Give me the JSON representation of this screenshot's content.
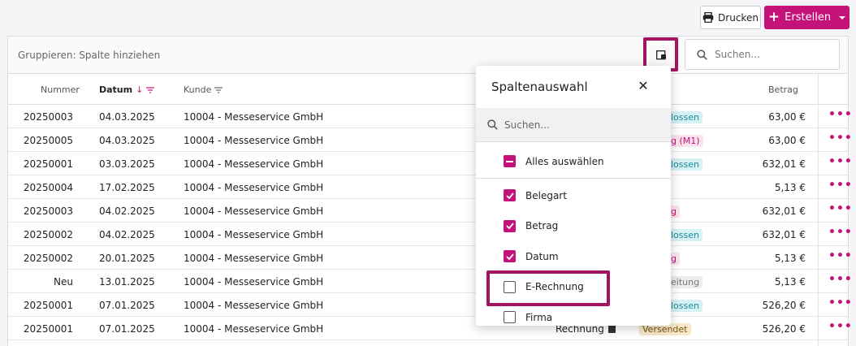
{
  "toolbar": {
    "print_label": "Drucken",
    "create_label": "Erstellen",
    "print_icon": "printer-icon",
    "create_icon": "plus-icon"
  },
  "groupbar": {
    "text": "Gruppieren: Spalte hinziehen",
    "search_placeholder": "Suchen..."
  },
  "columns": {
    "nummer": "Nummer",
    "datum": "Datum",
    "kunde": "Kunde",
    "betrag": "Betrag"
  },
  "rows": [
    {
      "nummer": "20250003",
      "datum": "04.03.2025",
      "kunde": "10004 - Messeservice GmbH",
      "status": "lossen",
      "status_color": "blue",
      "betrag": "63,00 €"
    },
    {
      "nummer": "20250005",
      "datum": "04.03.2025",
      "kunde": "10004 - Messeservice GmbH",
      "status": "g (M1)",
      "status_color": "pink",
      "betrag": "63,00 €"
    },
    {
      "nummer": "20250001",
      "datum": "03.03.2025",
      "kunde": "10004 - Messeservice GmbH",
      "status": "lossen",
      "status_color": "blue",
      "betrag": "632,01 €"
    },
    {
      "nummer": "20250004",
      "datum": "17.02.2025",
      "kunde": "10004 - Messeservice GmbH",
      "status": "",
      "status_color": "none",
      "betrag": "5,13 €"
    },
    {
      "nummer": "20250003",
      "datum": "04.02.2025",
      "kunde": "10004 - Messeservice GmbH",
      "status": "g",
      "status_color": "pink",
      "betrag": "632,01 €"
    },
    {
      "nummer": "20250002",
      "datum": "04.02.2025",
      "kunde": "10004 - Messeservice GmbH",
      "status": "lossen",
      "status_color": "blue",
      "betrag": "632,01 €"
    },
    {
      "nummer": "20250002",
      "datum": "20.01.2025",
      "kunde": "10004 - Messeservice GmbH",
      "status": "g",
      "status_color": "pink",
      "betrag": "5,13 €"
    },
    {
      "nummer": "Neu",
      "datum": "13.01.2025",
      "kunde": "10004 - Messeservice GmbH",
      "status": "eitung",
      "status_color": "grey",
      "betrag": "5,13 €"
    },
    {
      "nummer": "20250001",
      "datum": "07.01.2025",
      "kunde": "10004 - Messeservice GmbH",
      "status": "lossen",
      "status_color": "blue",
      "betrag": "526,20 €"
    },
    {
      "nummer": "20250001",
      "datum": "07.01.2025",
      "kunde": "10004 - Messeservice GmbH",
      "belegart": "Rechnung",
      "status": "Versendet",
      "status_color": "sent",
      "betrag": "526,20 €"
    }
  ],
  "popover": {
    "title": "Spaltenauswahl",
    "search_placeholder": "Suchen...",
    "select_all": "Alles auswählen",
    "items": [
      {
        "label": "Belegart",
        "checked": true
      },
      {
        "label": "Betrag",
        "checked": true
      },
      {
        "label": "Datum",
        "checked": true
      },
      {
        "label": "E-Rechnung",
        "checked": false
      },
      {
        "label": "Firma",
        "checked": false
      }
    ]
  },
  "colors": {
    "accent": "#c4127a",
    "highlight": "#a3135f"
  }
}
